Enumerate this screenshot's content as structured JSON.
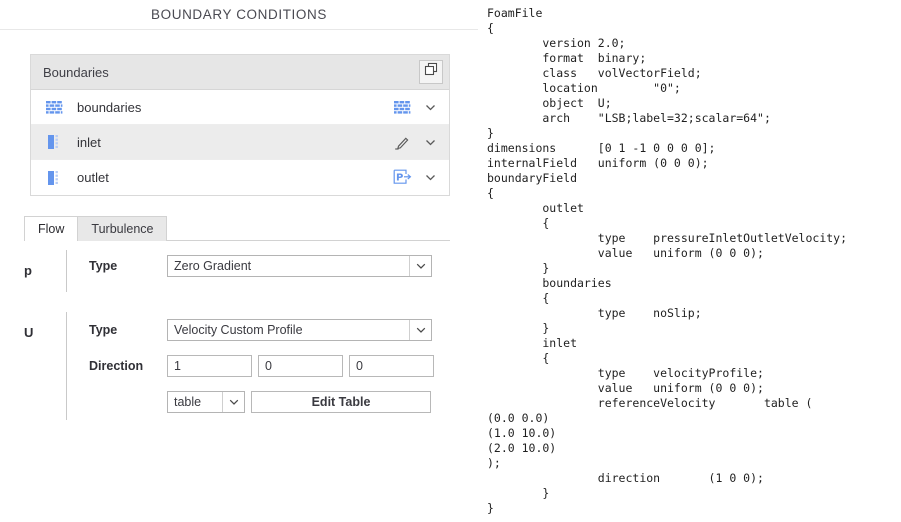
{
  "panel": {
    "title": "BOUNDARY CONDITIONS"
  },
  "boundaries_card": {
    "header_label": "Boundaries",
    "copy_button_title": "Duplicate",
    "rows": [
      {
        "label": "boundaries",
        "icon": "brick-wall-icon",
        "type_icon": "brick-wall-icon",
        "selected": false
      },
      {
        "label": "inlet",
        "icon": "inlet-patch-icon",
        "type_icon": "pencil-icon",
        "selected": true
      },
      {
        "label": "outlet",
        "icon": "inlet-patch-icon",
        "type_icon": "pressure-outlet-icon",
        "selected": false
      }
    ]
  },
  "tabs": [
    {
      "label": "Flow",
      "active": true
    },
    {
      "label": "Turbulence",
      "active": false
    }
  ],
  "form": {
    "p": {
      "var_label": "p",
      "type_label": "Type",
      "type_value": "Zero Gradient"
    },
    "u": {
      "var_label": "U",
      "type_label": "Type",
      "type_value": "Velocity Custom Profile",
      "direction_label": "Direction",
      "direction": [
        "1",
        "0",
        "0"
      ],
      "profile_mode": "table",
      "edit_table_button": "Edit Table"
    }
  },
  "code": {
    "text": "FoamFile\n{\n        version 2.0;\n        format  binary;\n        class   volVectorField;\n        location        \"0\";\n        object  U;\n        arch    \"LSB;label=32;scalar=64\";\n}\ndimensions      [0 1 -1 0 0 0 0];\ninternalField   uniform (0 0 0);\nboundaryField\n{\n        outlet\n        {\n                type    pressureInletOutletVelocity;\n                value   uniform (0 0 0);\n        }\n        boundaries\n        {\n                type    noSlip;\n        }\n        inlet\n        {\n                type    velocityProfile;\n                value   uniform (0 0 0);\n                referenceVelocity       table (\n(0.0 0.0)\n(1.0 10.0)\n(2.0 10.0)\n);\n                direction       (1 0 0);\n        }\n}"
  },
  "colors": {
    "accent_blue": "#6495ed",
    "panel_header_gray": "#e6e6e6",
    "selected_row_gray": "#ececec",
    "text_dark": "#333338"
  }
}
